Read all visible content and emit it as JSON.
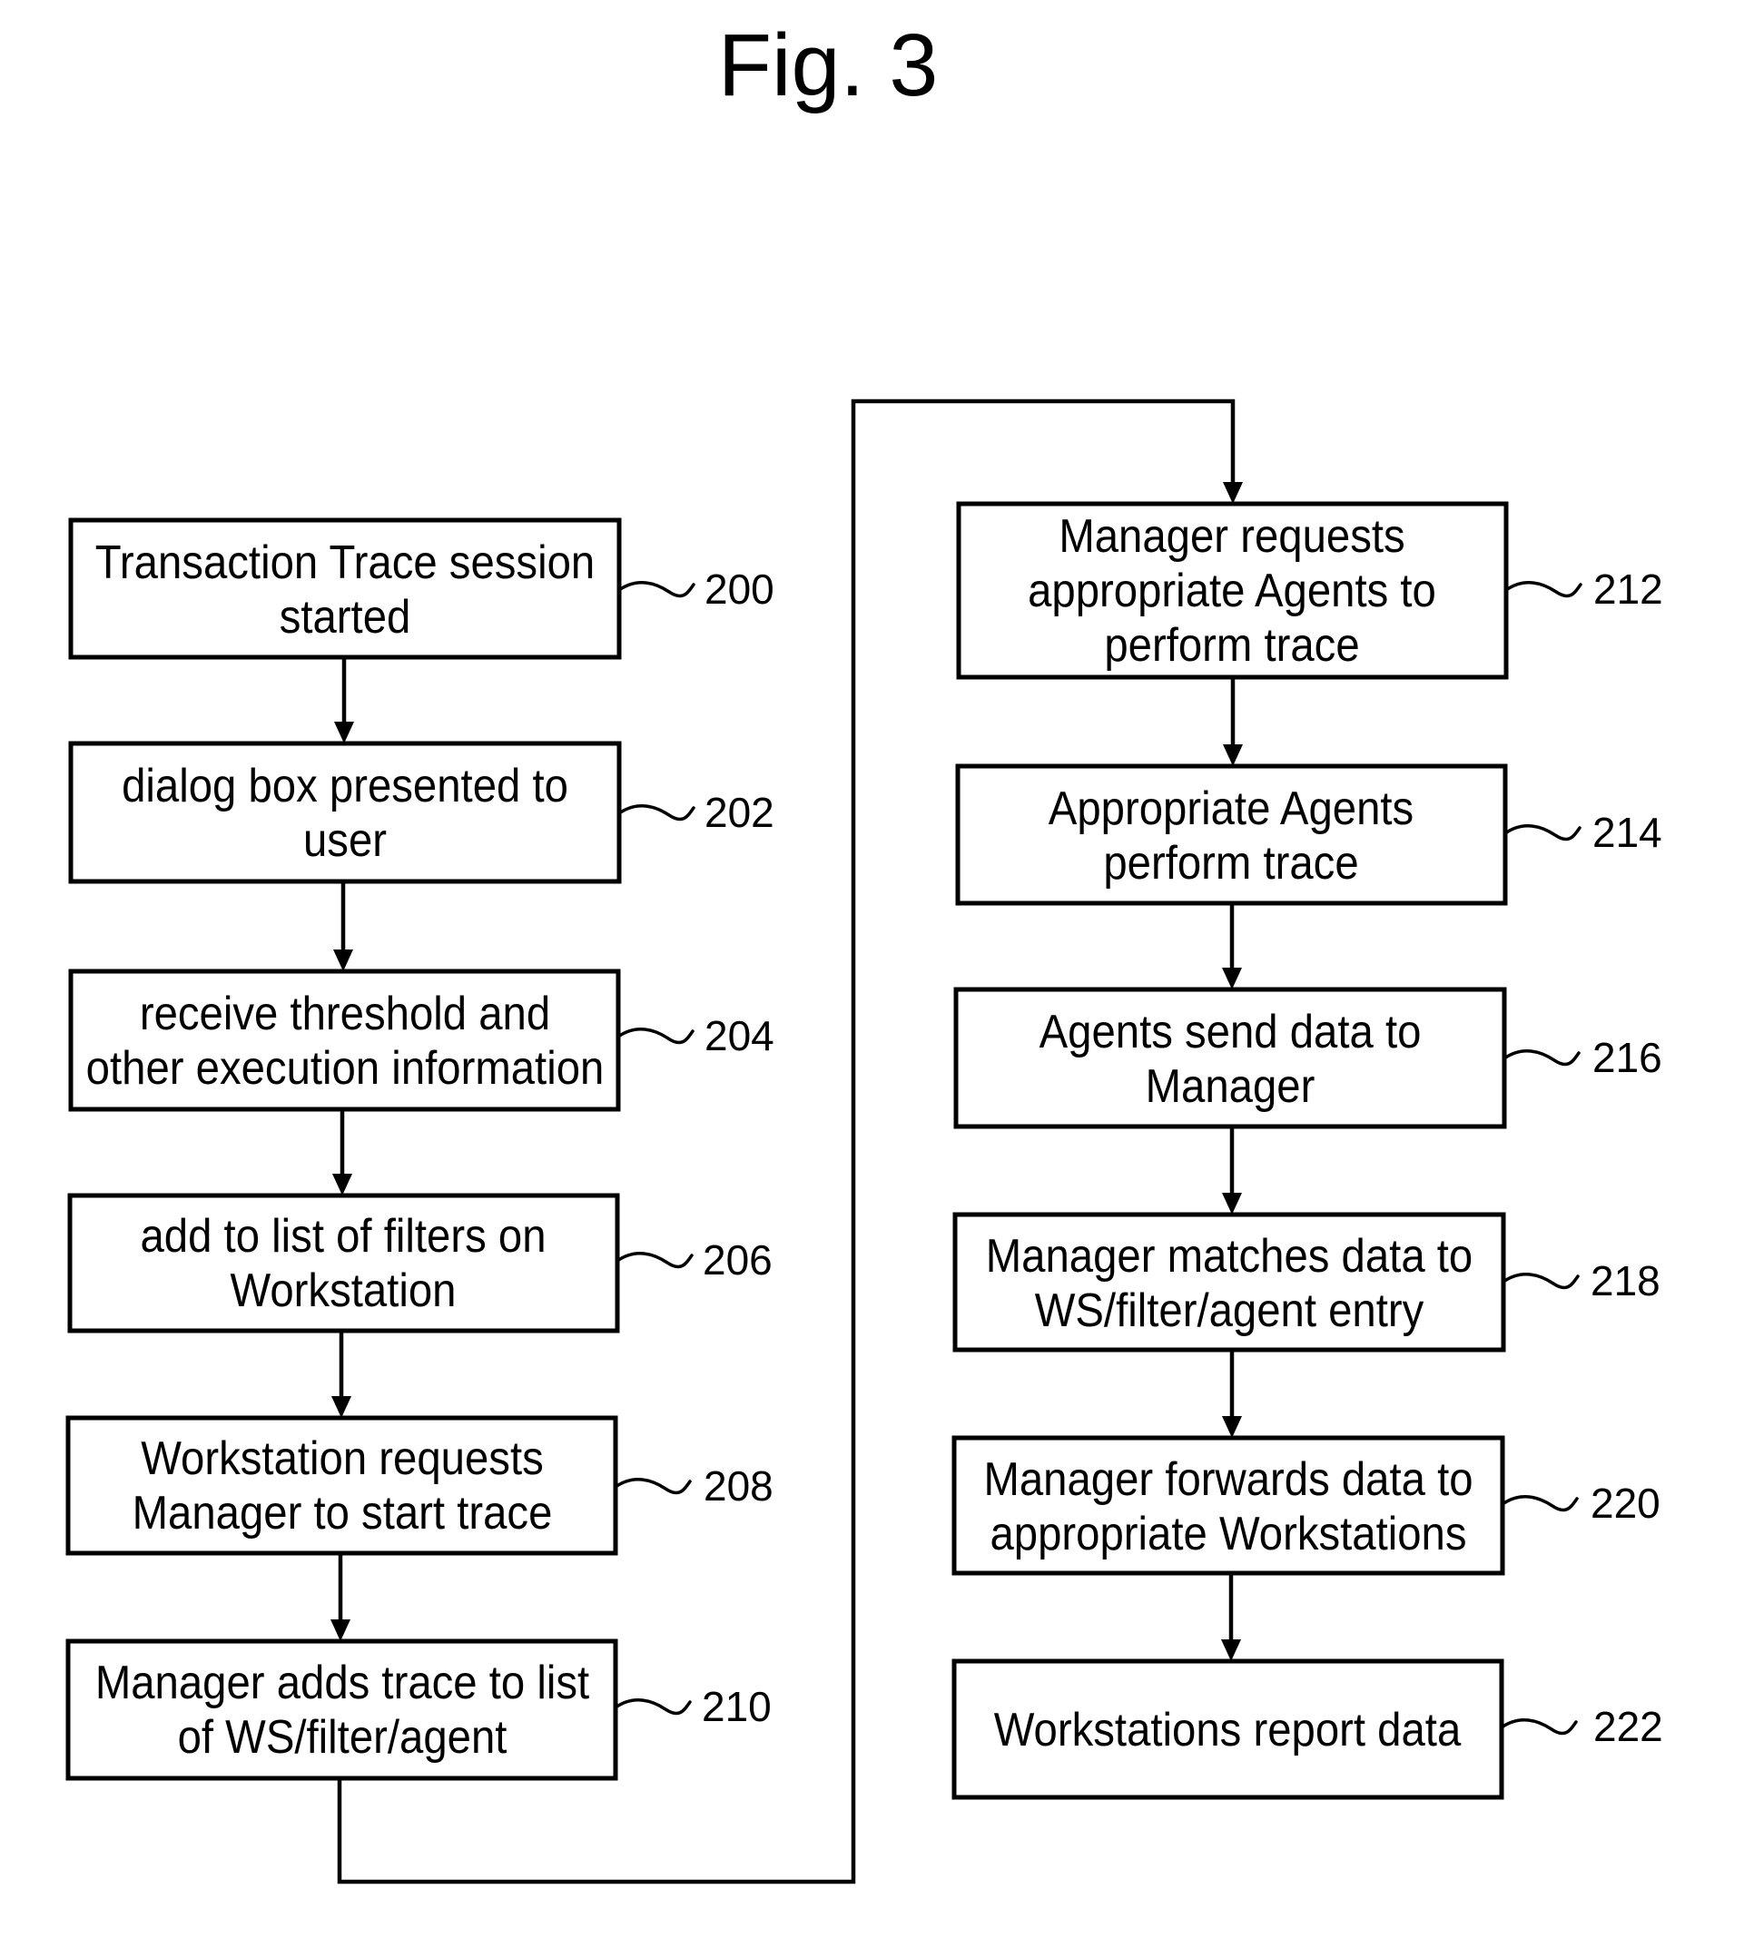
{
  "figure": {
    "title": "Fig. 3",
    "colors": {
      "ink": "#000000",
      "background": "#ffffff"
    }
  },
  "steps": [
    {
      "ref": "200",
      "lines": [
        "Transaction Trace session",
        "started"
      ]
    },
    {
      "ref": "202",
      "lines": [
        "dialog box presented to",
        "user"
      ]
    },
    {
      "ref": "204",
      "lines": [
        "receive threshold and",
        "other execution information"
      ]
    },
    {
      "ref": "206",
      "lines": [
        "add to list of filters on",
        "Workstation"
      ]
    },
    {
      "ref": "208",
      "lines": [
        "Workstation requests",
        "Manager to start trace"
      ]
    },
    {
      "ref": "210",
      "lines": [
        "Manager adds trace to list",
        "of WS/filter/agent"
      ]
    },
    {
      "ref": "212",
      "lines": [
        "Manager requests",
        "appropriate Agents to",
        "perform trace"
      ]
    },
    {
      "ref": "214",
      "lines": [
        "Appropriate Agents",
        "perform trace"
      ]
    },
    {
      "ref": "216",
      "lines": [
        "Agents send data to",
        "Manager"
      ]
    },
    {
      "ref": "218",
      "lines": [
        "Manager matches data to",
        "WS/filter/agent entry"
      ]
    },
    {
      "ref": "220",
      "lines": [
        "Manager forwards data to",
        "appropriate Workstations"
      ]
    },
    {
      "ref": "222",
      "lines": [
        "Workstations report data"
      ]
    }
  ],
  "flow": [
    [
      "200",
      "202"
    ],
    [
      "202",
      "204"
    ],
    [
      "204",
      "206"
    ],
    [
      "206",
      "208"
    ],
    [
      "208",
      "210"
    ],
    [
      "210",
      "212"
    ],
    [
      "212",
      "214"
    ],
    [
      "214",
      "216"
    ],
    [
      "216",
      "218"
    ],
    [
      "218",
      "220"
    ],
    [
      "220",
      "222"
    ]
  ]
}
